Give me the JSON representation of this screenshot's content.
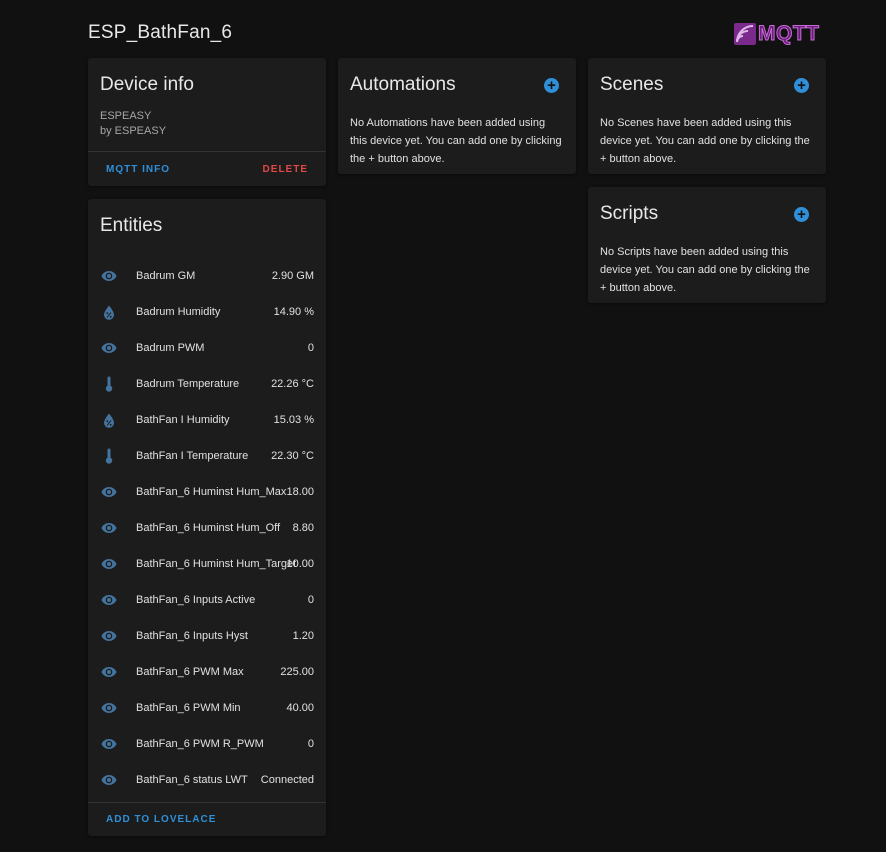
{
  "page": {
    "title": "ESP_BathFan_6"
  },
  "logo": {
    "text": "MQTT"
  },
  "device_info": {
    "title": "Device info",
    "model": "ESPEASY",
    "manufacturer": "by ESPEASY",
    "mqtt_info_label": "MQTT INFO",
    "delete_label": "DELETE"
  },
  "entities": {
    "title": "Entities",
    "add_to_lovelace_label": "ADD TO LOVELACE",
    "items": [
      {
        "icon": "eye-icon",
        "name": "Badrum GM",
        "state": "2.90 GM"
      },
      {
        "icon": "water-percent-icon",
        "name": "Badrum Humidity",
        "state": "14.90 %"
      },
      {
        "icon": "eye-icon",
        "name": "Badrum PWM",
        "state": "0"
      },
      {
        "icon": "thermometer-icon",
        "name": "Badrum Temperature",
        "state": "22.26 °C"
      },
      {
        "icon": "water-percent-icon",
        "name": "BathFan I Humidity",
        "state": "15.03 %"
      },
      {
        "icon": "thermometer-icon",
        "name": "BathFan I Temperature",
        "state": "22.30 °C"
      },
      {
        "icon": "eye-icon",
        "name": "BathFan_6 Huminst Hum_Max",
        "state": "18.00"
      },
      {
        "icon": "eye-icon",
        "name": "BathFan_6 Huminst Hum_Off",
        "state": "8.80"
      },
      {
        "icon": "eye-icon",
        "name": "BathFan_6 Huminst Hum_Target",
        "state": "10.00"
      },
      {
        "icon": "eye-icon",
        "name": "BathFan_6 Inputs Active",
        "state": "0"
      },
      {
        "icon": "eye-icon",
        "name": "BathFan_6 Inputs Hyst",
        "state": "1.20"
      },
      {
        "icon": "eye-icon",
        "name": "BathFan_6 PWM Max",
        "state": "225.00"
      },
      {
        "icon": "eye-icon",
        "name": "BathFan_6 PWM Min",
        "state": "40.00"
      },
      {
        "icon": "eye-icon",
        "name": "BathFan_6 PWM R_PWM",
        "state": "0"
      },
      {
        "icon": "eye-icon",
        "name": "BathFan_6 status LWT",
        "state": "Connected"
      }
    ]
  },
  "automations": {
    "title": "Automations",
    "empty_text": "No Automations have been added using this device yet. You can add one by clicking the + button above."
  },
  "scenes": {
    "title": "Scenes",
    "empty_text": "No Scenes have been added using this device yet. You can add one by clicking the + button above."
  },
  "scripts": {
    "title": "Scripts",
    "empty_text": "No Scripts have been added using this device yet. You can add one by clicking the + button above."
  },
  "colors": {
    "background": "#111111",
    "card": "#1c1c1c",
    "accent_blue": "#2f8fd8",
    "delete_red": "#e04848",
    "icon_blue": "#44739e"
  }
}
